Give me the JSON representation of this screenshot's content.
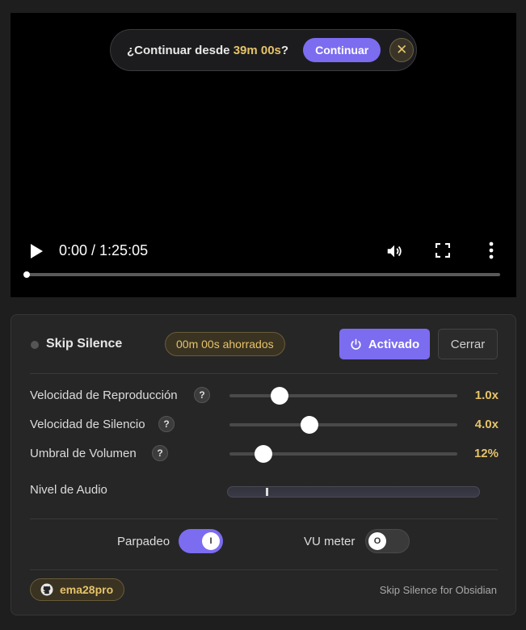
{
  "video": {
    "resume_prompt": {
      "text_prefix": "¿Continuar desde ",
      "time": "39m 00s",
      "text_suffix": "?",
      "continue_label": "Continuar",
      "close_symbol": "✕"
    },
    "time_display": "0:00 / 1:25:05",
    "progress_fraction": 0.0,
    "icons": [
      "play-icon",
      "volume-icon",
      "fullscreen-icon",
      "more-vertical-icon"
    ]
  },
  "panel": {
    "title": "Skip Silence",
    "saved_badge": "00m 00s ahorrados",
    "activate_label": "Activado",
    "close_label": "Cerrar",
    "settings": [
      {
        "label": "Velocidad de Reproducción",
        "help": "?",
        "value": "1.0x",
        "slider_fraction": 0.22
      },
      {
        "label": "Velocidad de Silencio",
        "help": "?",
        "value": "4.0x",
        "slider_fraction": 0.35
      },
      {
        "label": "Umbral de Volumen",
        "help": "?",
        "value": "12%",
        "slider_fraction": 0.15
      }
    ],
    "audio_level": {
      "label": "Nivel de Audio",
      "level_fraction": 0.15
    },
    "toggles": {
      "blink": {
        "label": "Parpadeo",
        "knob": "I",
        "on": true
      },
      "vu_meter": {
        "label": "VU meter",
        "knob": "O",
        "on": false
      }
    },
    "footer": {
      "github_user": "ema28pro",
      "app_name": "Skip Silence for Obsidian"
    }
  },
  "colors": {
    "accent": "#7b6cf0",
    "gold": "#e6c36a",
    "background": "#1e1e1e",
    "panel": "#262626"
  }
}
